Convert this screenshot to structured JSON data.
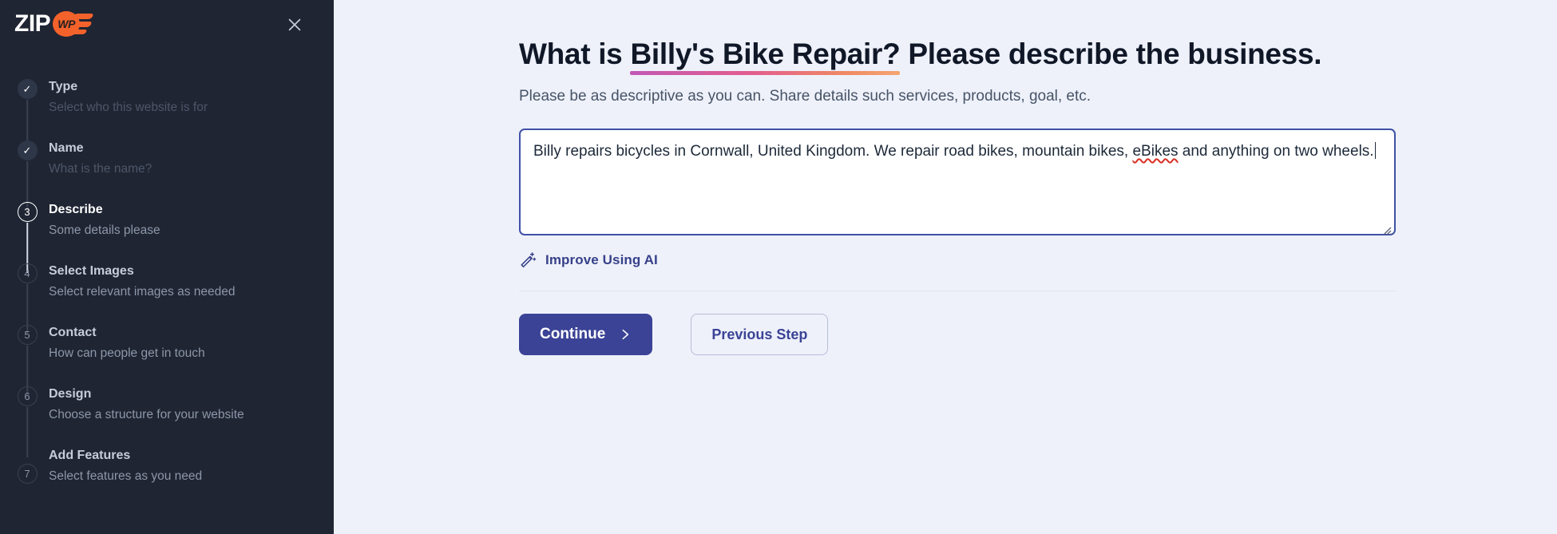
{
  "sidebar": {
    "logo": {
      "text_main": "ZIP",
      "text_badge": "WP"
    },
    "close_label": "close-icon",
    "steps": [
      {
        "marker": "✓",
        "state": "done",
        "title": "Type",
        "subtitle": "Select who this website is for"
      },
      {
        "marker": "✓",
        "state": "done",
        "title": "Name",
        "subtitle": "What is the name?"
      },
      {
        "marker": "3",
        "state": "current",
        "title": "Describe",
        "subtitle": "Some details please"
      },
      {
        "marker": "4",
        "state": "todo",
        "title": "Select Images",
        "subtitle": "Select relevant images as needed"
      },
      {
        "marker": "5",
        "state": "todo",
        "title": "Contact",
        "subtitle": "How can people get in touch"
      },
      {
        "marker": "6",
        "state": "todo",
        "title": "Design",
        "subtitle": "Choose a structure for your website"
      },
      {
        "marker": "7",
        "state": "todo",
        "title": "Add Features",
        "subtitle": "Select features as you need"
      }
    ]
  },
  "main": {
    "title_prefix": "What is ",
    "title_highlight": "Billy's Bike Repair?",
    "title_suffix": " Please describe the business.",
    "subtitle": "Please be as descriptive as you can. Share details such services, products, goal, etc.",
    "textarea": {
      "value": "Billy repairs bicycles in Cornwall, United Kingdom. We repair road bikes, mountain bikes, eBikes and anything on two wheels.",
      "placeholder": "",
      "text_before_misspelling": "Billy repairs bicycles in Cornwall, United Kingdom. We repair road bikes, mountain bikes, ",
      "misspelled_word": "eBikes",
      "text_after_misspelling": " and anything on two wheels."
    },
    "improve_ai_label": "Improve Using AI",
    "continue_label": "Continue",
    "previous_label": "Previous Step"
  },
  "colors": {
    "sidebar_bg": "#1f2533",
    "main_bg": "#eef1fa",
    "accent_indigo": "#3b4396",
    "logo_orange": "#f4622b",
    "underline_from": "#c258b5",
    "underline_to": "#f5a571",
    "spellcheck_red": "#d93025"
  }
}
